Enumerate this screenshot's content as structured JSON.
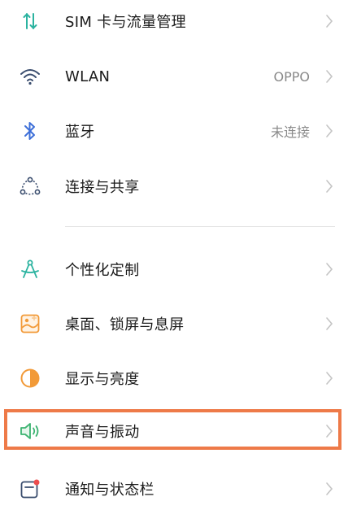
{
  "settings": {
    "items": [
      {
        "label": "SIM 卡与流量管理",
        "value": "",
        "icon": "sim-data-icon"
      },
      {
        "label": "WLAN",
        "value": "OPPO",
        "icon": "wifi-icon"
      },
      {
        "label": "蓝牙",
        "value": "未连接",
        "icon": "bluetooth-icon"
      },
      {
        "label": "连接与共享",
        "value": "",
        "icon": "share-connect-icon"
      },
      {
        "label": "个性化定制",
        "value": "",
        "icon": "personalize-icon"
      },
      {
        "label": "桌面、锁屏与息屏",
        "value": "",
        "icon": "wallpaper-icon"
      },
      {
        "label": "显示与亮度",
        "value": "",
        "icon": "brightness-icon"
      },
      {
        "label": "声音与振动",
        "value": "",
        "icon": "sound-icon"
      },
      {
        "label": "通知与状态栏",
        "value": "",
        "icon": "notification-icon"
      }
    ]
  },
  "colors": {
    "highlight": "#ee7a48",
    "teal": "#2bb3a0",
    "blue": "#3d6fd8",
    "orange": "#f29a38",
    "green": "#3cb371"
  }
}
